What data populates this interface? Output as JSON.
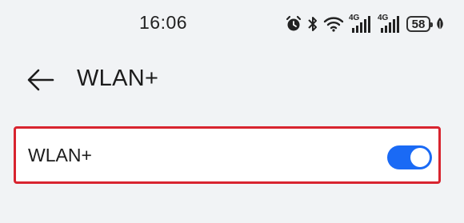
{
  "status_bar": {
    "time": "16:06",
    "network_1": "4G",
    "network_2": "4G",
    "battery_level": "58",
    "icons": [
      "alarm-icon",
      "bluetooth-icon",
      "wifi-icon",
      "signal-icon",
      "signal-icon",
      "battery-icon",
      "leaf-icon"
    ]
  },
  "header": {
    "title": "WLAN+",
    "back_icon": "back-arrow-icon"
  },
  "settings": {
    "wlan_plus": {
      "label": "WLAN+",
      "enabled": true
    }
  },
  "colors": {
    "accent": "#1a6af5",
    "highlight_border": "#d8242f",
    "background": "#f1f3f5"
  }
}
